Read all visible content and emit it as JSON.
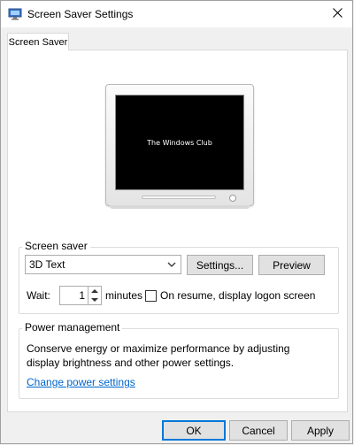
{
  "window": {
    "title": "Screen Saver Settings"
  },
  "tabs": [
    {
      "label": "Screen Saver"
    }
  ],
  "preview": {
    "screen_text": "The Windows Club"
  },
  "screen_saver": {
    "group_label": "Screen saver",
    "selected": "3D Text",
    "settings_label": "Settings...",
    "preview_label": "Preview",
    "wait_label": "Wait:",
    "wait_value": "1",
    "minutes_label": "minutes",
    "resume_label": "On resume, display logon screen",
    "resume_checked": false
  },
  "power": {
    "group_label": "Power management",
    "description_line1": "Conserve energy or maximize performance by adjusting",
    "description_line2": "display brightness and other power settings.",
    "link_label": "Change power settings"
  },
  "buttons": {
    "ok": "OK",
    "cancel": "Cancel",
    "apply": "Apply"
  },
  "colors": {
    "accent": "#0078d7",
    "link": "#0066cc"
  }
}
